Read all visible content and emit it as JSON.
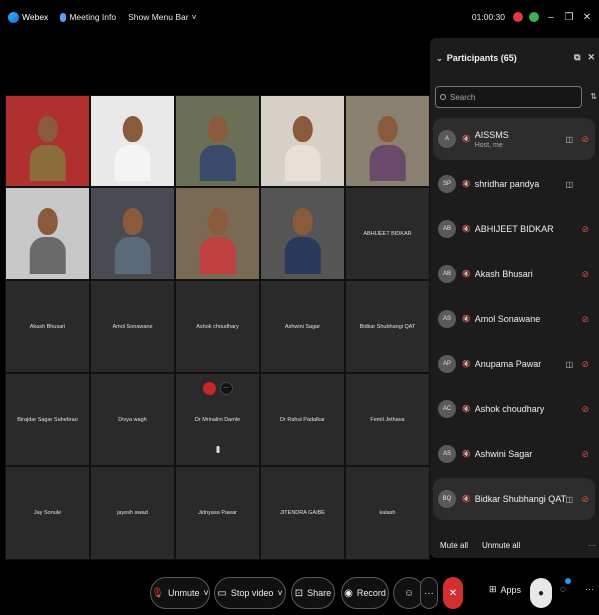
{
  "topbar": {
    "app_name": "Webex",
    "meeting_info": "Meeting Info",
    "show_menu_bar": "Show Menu Bar",
    "menu_chevron": "˅",
    "timer": "01:00:30",
    "minimize": "–",
    "restore": "❐",
    "close": "✕"
  },
  "grid": {
    "video_tiles": [
      {
        "shirt": "#8a6d3b",
        "bg": "#b03030"
      },
      {
        "shirt": "#f4f4f4",
        "bg": "#e9e9e9"
      },
      {
        "shirt": "#3a4a6a",
        "bg": "#6b6f55"
      },
      {
        "shirt": "#e8e0d8",
        "bg": "#d6d0c6"
      },
      {
        "shirt": "#6a4a6a",
        "bg": "#8a8070"
      },
      {
        "shirt": "#6a6a6a",
        "bg": "#c8c8c8"
      },
      {
        "shirt": "#5a6a7a",
        "bg": "#4a4a52"
      },
      {
        "shirt": "#c04040",
        "bg": "#7a6a55"
      },
      {
        "shirt": "#2a3a5a",
        "bg": "#555555"
      }
    ],
    "name_tiles": [
      "ABHIJEET BIDKAR",
      "Akash Bhusari",
      "Amol Sonawane",
      "Ashok choudhary",
      "Ashwini Sagar",
      "Bidkar Shubhangi QAT",
      "Birajdar Sagar Sahebrao",
      "Divya wagh",
      "Dr Mrinalini Damle",
      "Dr Rahul Padalkar",
      "Femil Jethava",
      "Jay Sonule",
      "jayesh awad",
      "Jidnyasa Pawar",
      "JITENDRA GAIBE",
      "kalash"
    ],
    "tile_action_more": "···"
  },
  "panel": {
    "title": "Participants (65)",
    "search_placeholder": "Search",
    "participants": [
      {
        "initials": "A",
        "name": "AISSMS",
        "sub": "Host, me",
        "share": true
      },
      {
        "initials": "SP",
        "name": "shridhar pandya",
        "sub": "",
        "share": true
      },
      {
        "initials": "AB",
        "name": "ABHIJEET BIDKAR",
        "sub": "",
        "share": false
      },
      {
        "initials": "AB",
        "name": "Akash Bhusari",
        "sub": "",
        "share": false
      },
      {
        "initials": "AS",
        "name": "Amol Sonawane",
        "sub": "",
        "share": false
      },
      {
        "initials": "AP",
        "name": "Anupama Pawar",
        "sub": "",
        "share": true
      },
      {
        "initials": "AC",
        "name": "Ashok choudhary",
        "sub": "",
        "share": false
      },
      {
        "initials": "AS",
        "name": "Ashwini Sagar",
        "sub": "",
        "share": false
      },
      {
        "initials": "BQ",
        "name": "Bidkar Shubhangi QAT",
        "sub": "",
        "share": true
      }
    ],
    "mute_all": "Mute all",
    "unmute_all": "Unmute all",
    "more": "···"
  },
  "toolbar": {
    "unmute": "Unmute",
    "stop_video": "Stop video",
    "share": "Share",
    "record": "Record",
    "apps": "Apps",
    "more": "···",
    "chevron": "˅"
  }
}
